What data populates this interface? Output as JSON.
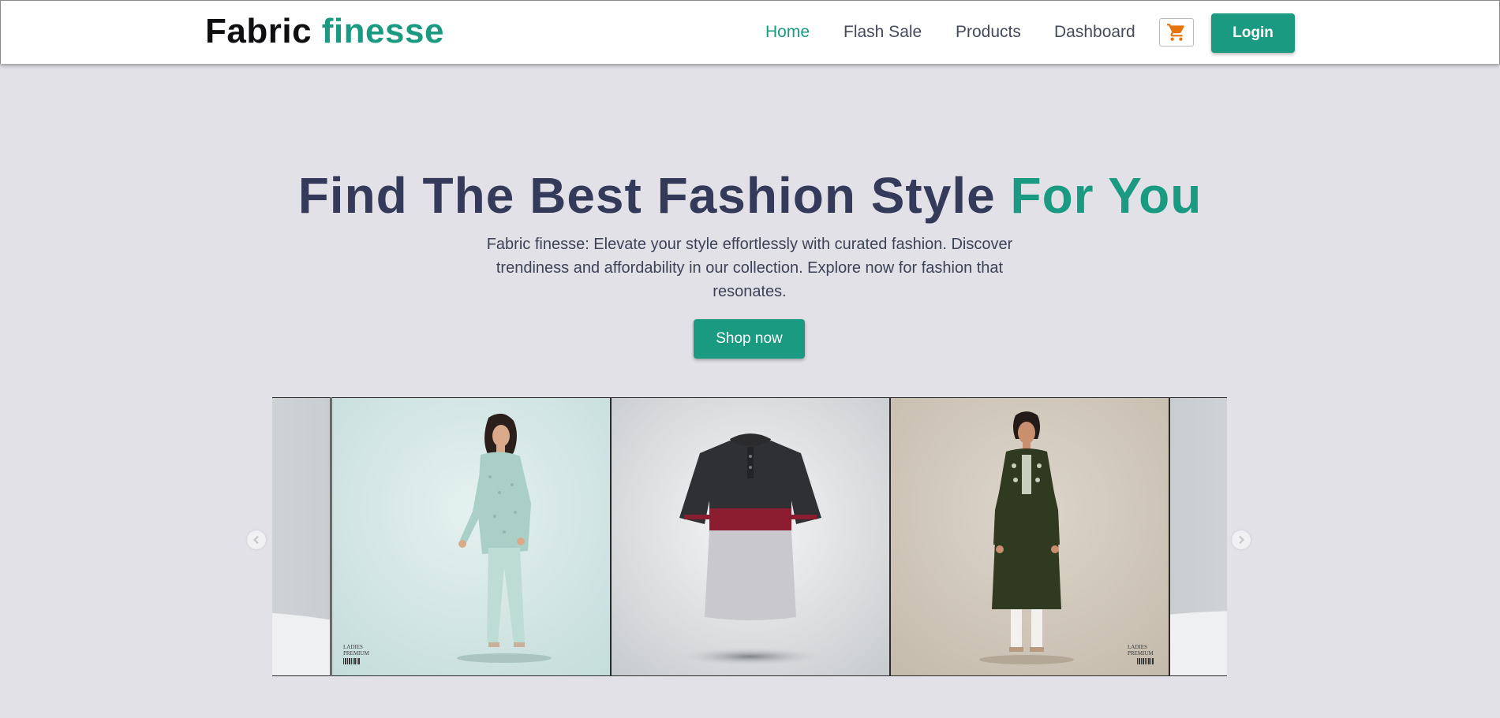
{
  "header": {
    "brand_part1": "Fabric",
    "brand_part2": "finesse",
    "nav": [
      {
        "label": "Home",
        "active": true
      },
      {
        "label": "Flash Sale",
        "active": false
      },
      {
        "label": "Products",
        "active": false
      },
      {
        "label": "Dashboard",
        "active": false
      }
    ],
    "cart_icon": "shopping-cart-icon",
    "login_label": "Login"
  },
  "hero": {
    "title_main": "Find The Best Fashion Style",
    "title_accent": "For You",
    "description": "Fabric finesse: Elevate your style effortlessly with curated fashion. Discover trendiness and affordability in our collection. Explore now for fashion that resonates.",
    "cta_label": "Shop now"
  },
  "carousel": {
    "prev_icon": "chevron-left-icon",
    "next_icon": "chevron-right-icon",
    "slides": [
      {
        "subject": "partial-product-image"
      },
      {
        "subject": "woman-in-mint-co-ord-set",
        "tag_line1": "LADIES",
        "tag_line2": "PREMIUM"
      },
      {
        "subject": "polo-shirt-black-red-grey"
      },
      {
        "subject": "woman-in-green-kurti",
        "tag_line1": "LADIES",
        "tag_line2": "PREMIUM"
      },
      {
        "subject": "partial-product-image"
      }
    ]
  },
  "colors": {
    "brand_accent": "#1a9a80",
    "title_text": "#343a59",
    "page_background": "#e2e1e7",
    "cart_icon": "#e8740d"
  }
}
